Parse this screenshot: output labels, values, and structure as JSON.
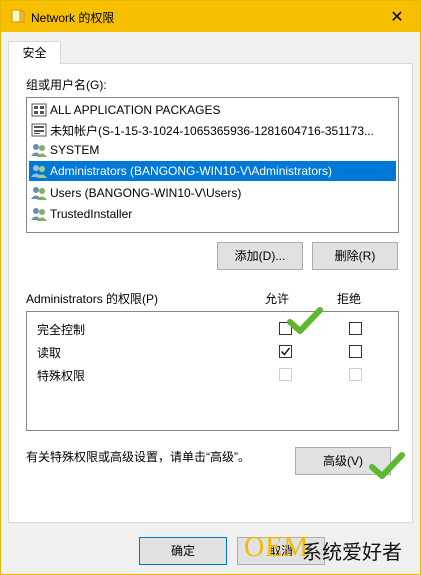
{
  "window": {
    "title": "Network 的权限",
    "close_glyph": "✕"
  },
  "tab": {
    "label": "安全"
  },
  "users": {
    "label": "组或用户名(G):",
    "items": [
      {
        "name": "ALL APPLICATION PACKAGES",
        "icon": "app-packages-icon",
        "selected": false
      },
      {
        "name": "未知帐户(S-1-15-3-1024-1065365936-1281604716-351173...",
        "icon": "unknown-account-icon",
        "selected": false
      },
      {
        "name": "SYSTEM",
        "icon": "users-group-icon",
        "selected": false
      },
      {
        "name": "Administrators (BANGONG-WIN10-V\\Administrators)",
        "icon": "users-group-icon",
        "selected": true
      },
      {
        "name": "Users (BANGONG-WIN10-V\\Users)",
        "icon": "users-group-icon",
        "selected": false
      },
      {
        "name": "TrustedInstaller",
        "icon": "users-group-icon",
        "selected": false
      }
    ]
  },
  "buttons": {
    "add": "添加(D)...",
    "remove": "删除(R)",
    "advanced": "高级(V)",
    "ok": "确定",
    "cancel": "取消"
  },
  "permissions": {
    "label": "Administrators 的权限(P)",
    "allow_header": "允许",
    "deny_header": "拒绝",
    "rows": [
      {
        "name": "完全控制",
        "allow": false,
        "deny": false,
        "enabled": true
      },
      {
        "name": "读取",
        "allow": true,
        "deny": false,
        "enabled": true
      },
      {
        "name": "特殊权限",
        "allow": false,
        "deny": false,
        "enabled": false
      }
    ]
  },
  "advanced_hint": "有关特殊权限或高级设置，请单击“高级”。",
  "watermark": {
    "brand": "OEM",
    "text": "系统爱好者"
  },
  "colors": {
    "titlebar": "#f6c000",
    "selection": "#0078d7",
    "check_green": "#5cb82e",
    "watermark_gold": "#f6b800"
  }
}
